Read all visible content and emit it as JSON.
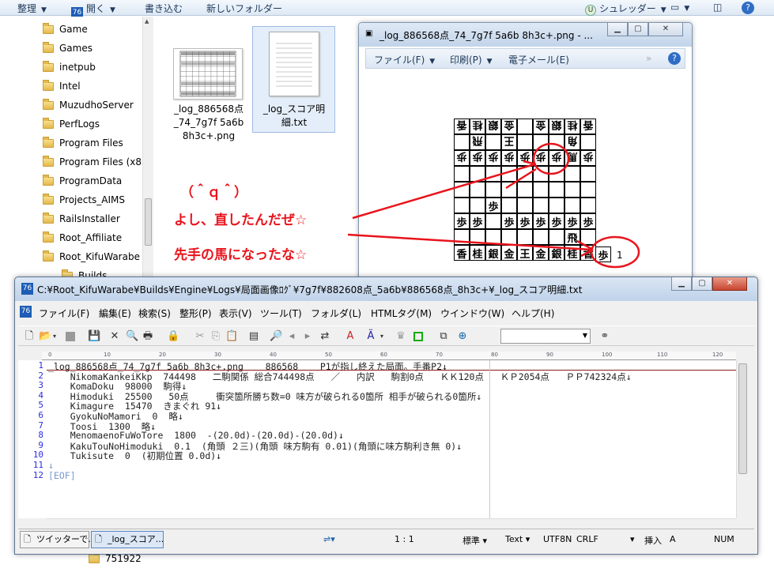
{
  "explorer": {
    "toolbar": {
      "organize": "整理",
      "open": "開く",
      "burn": "書き込む",
      "new_folder": "新しいフォルダー",
      "shredder": "シュレッダー"
    },
    "nav_items": [
      "Game",
      "Games",
      "inetpub",
      "Intel",
      "MuzudhoServer",
      "PerfLogs",
      "Program Files",
      "Program Files (x8",
      "ProgramData",
      "Projects_AIMS",
      "RailsInstaller",
      "Root_Affiliate",
      "Root_KifuWarabe",
      "Builds"
    ],
    "bottom_item": "751922",
    "files": [
      {
        "name": "_log_886568点_74_7g7f 5a6b 8h3c+.png"
      },
      {
        "name": "_log_スコア明細.txt"
      }
    ]
  },
  "viewer": {
    "title": "_log_886568点_74_7g7f 5a6b 8h3c+.png - ...",
    "menu": {
      "file": "ファイル(F)",
      "print": "印刷(P)",
      "email": "電子メール(E)"
    },
    "hand_count": "1"
  },
  "board": {
    "rows": [
      [
        "香",
        "桂",
        "銀",
        "金",
        "",
        "金",
        "銀",
        "桂",
        "香"
      ],
      [
        "",
        "飛",
        "",
        "王",
        "",
        "",
        "",
        "角",
        ""
      ],
      [
        "歩",
        "歩",
        "歩",
        "歩",
        "歩",
        "歩",
        "歩",
        "馬",
        "歩"
      ],
      [
        "",
        "",
        "",
        "",
        "",
        "",
        "",
        "",
        ""
      ],
      [
        "",
        "",
        "",
        "",
        "",
        "",
        "",
        "",
        ""
      ],
      [
        "",
        "",
        "歩",
        "",
        "",
        "",
        "",
        "",
        ""
      ],
      [
        "歩",
        "歩",
        "",
        "歩",
        "歩",
        "歩",
        "歩",
        "歩",
        "歩"
      ],
      [
        "",
        "",
        "",
        "",
        "",
        "",
        "",
        "飛",
        ""
      ],
      [
        "香",
        "桂",
        "銀",
        "金",
        "王",
        "金",
        "銀",
        "桂",
        "香"
      ]
    ],
    "inverted_rows": [
      0,
      1,
      2
    ]
  },
  "annotations": {
    "line1": "（＾ｑ＾）",
    "line2": "よし、直したんだぜ☆",
    "line3": "先手の馬になったな☆",
    "color": "#e8141c"
  },
  "editor": {
    "title": "C:¥Root_KifuWarabe¥Builds¥Engine¥Logs¥局面画像ﾛｸﾞ¥7g7f¥882608点_5a6b¥886568点_8h3c+¥_log_スコア明細.txt",
    "menu": [
      "ファイル(F)",
      "編集(E)",
      "検索(S)",
      "整形(P)",
      "表示(V)",
      "ツール(T)",
      "フォルダ(L)",
      "HTMLタグ(M)",
      "ウインドウ(W)",
      "ヘルプ(H)"
    ],
    "ruler": [
      "0",
      "10",
      "20",
      "30",
      "40",
      "50",
      "60",
      "70",
      "80",
      "90",
      "100",
      "110",
      "120"
    ],
    "lines": [
      "_log_886568点_74_7g7f 5a6b 8h3c+.png    886568    P1が指し終えた局面。手番P2↓",
      "    NikomaKankeiKkp  744498   二駒関係 総合744498点   ／   内訳   駒割0点   ＫＫ120点   ＫＰ2054点   ＰＰ742324点↓",
      "    KomaDoku  98000  駒得↓",
      "    Himoduki  25500   50点     衝突箇所勝ち数=0 味方が破られる0箇所 相手が破られる0箇所↓",
      "    Kimagure  15470  きまぐれ 91↓",
      "    GyokuNoMamori  0  略↓",
      "    Toosi  1300  略↓",
      "    MenomaenoFuWoTore  1800  -(20.0d)-(20.0d)-(20.0d)↓",
      "    KakuTouNoHimoduki  0.1  (角頭 ２三)(角頭 味方駒有 0.01)(角頭に味方駒利き無 0)↓",
      "    Tukisute  0  (初期位置 0.0d)↓",
      "↓",
      "[EOF]"
    ],
    "tabs": [
      "ツイッターで...",
      "_log_スコア..."
    ],
    "status": {
      "position": "1 : 1",
      "mode": "標準",
      "type": "Text",
      "encoding": "UTF8N",
      "eol": "CRLF",
      "insert": "挿入",
      "a": "A",
      "num": "NUM"
    }
  }
}
